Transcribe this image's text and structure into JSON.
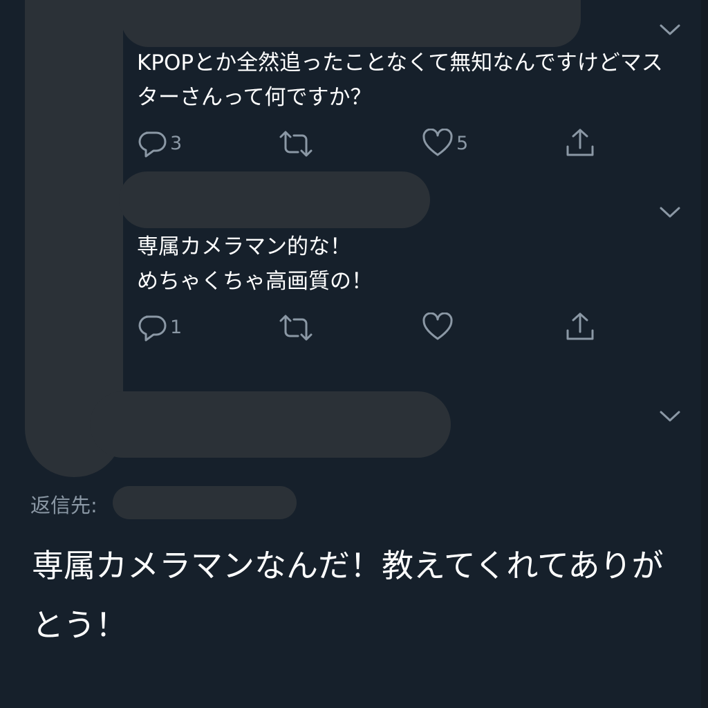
{
  "thread": {
    "tweets": [
      {
        "text": "KPOPとか全然追ったことなくて無知なんですけどマスターさんって何ですか？",
        "reply_count": "3",
        "retweet_count": "",
        "like_count": "5"
      },
      {
        "text": "専属カメラマン的な！\nめちゃくちゃ高画質の！",
        "reply_count": "1",
        "retweet_count": "",
        "like_count": ""
      }
    ]
  },
  "focused": {
    "reply_to_label": "返信先:",
    "text": "専属カメラマンなんだ！教えてくれてありがとう！"
  },
  "icons": {
    "more": "chevron-down-icon",
    "reply": "reply-icon",
    "retweet": "retweet-icon",
    "like": "heart-icon",
    "share": "share-icon"
  },
  "colors": {
    "background": "#16202b",
    "icon": "#8b98a5",
    "text": "#ffffff",
    "redaction": "#2b3137"
  }
}
